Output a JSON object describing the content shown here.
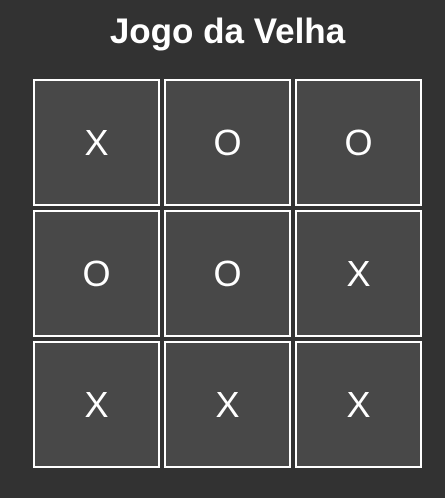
{
  "title": "Jogo da Velha",
  "board": {
    "cells": [
      "X",
      "O",
      "O",
      "O",
      "O",
      "X",
      "X",
      "X",
      "X"
    ]
  },
  "colors": {
    "background": "#323232",
    "cell_background": "#484848",
    "cell_border": "#ffffff",
    "text": "#ffffff"
  }
}
